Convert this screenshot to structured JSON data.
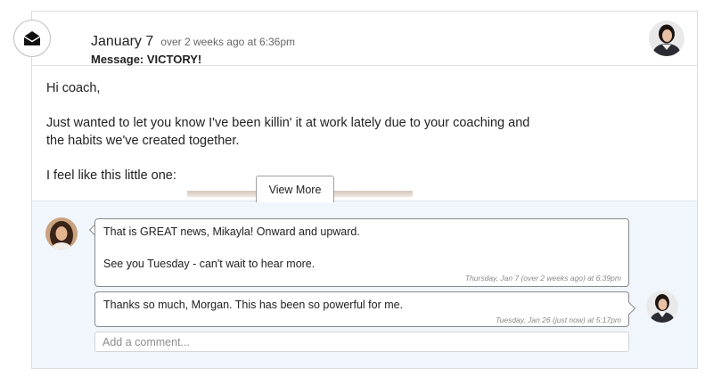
{
  "header": {
    "date": "January 7",
    "relative_time": "over 2 weeks ago at 6:36pm",
    "subject": "Message: VICTORY!",
    "icon": "envelope-open-icon"
  },
  "message": {
    "greeting": "Hi coach,",
    "paragraph1_line1": "Just wanted to let you know I've been killin' it at work lately due to your coaching and",
    "paragraph1_line2": "the habits we've created together.",
    "paragraph2": "I feel like this little one:",
    "view_more_label": "View More"
  },
  "comments": [
    {
      "line1": "That is GREAT news, Mikayla! Onward and upward.",
      "line2": "See you Tuesday - can't wait to hear more.",
      "timestamp": "Thursday, Jan 7 (over 2 weeks ago) at 6:39pm"
    },
    {
      "line1": "Thanks so much, Morgan. This has been so powerful for me.",
      "timestamp": "Tuesday, Jan 26 (just now) at 5:17pm"
    }
  ],
  "comment_input": {
    "placeholder": "Add a comment...",
    "value": ""
  },
  "colors": {
    "comments_bg": "#f0f6fc",
    "bubble_border": "#8a8a8a",
    "text": "#222222"
  }
}
